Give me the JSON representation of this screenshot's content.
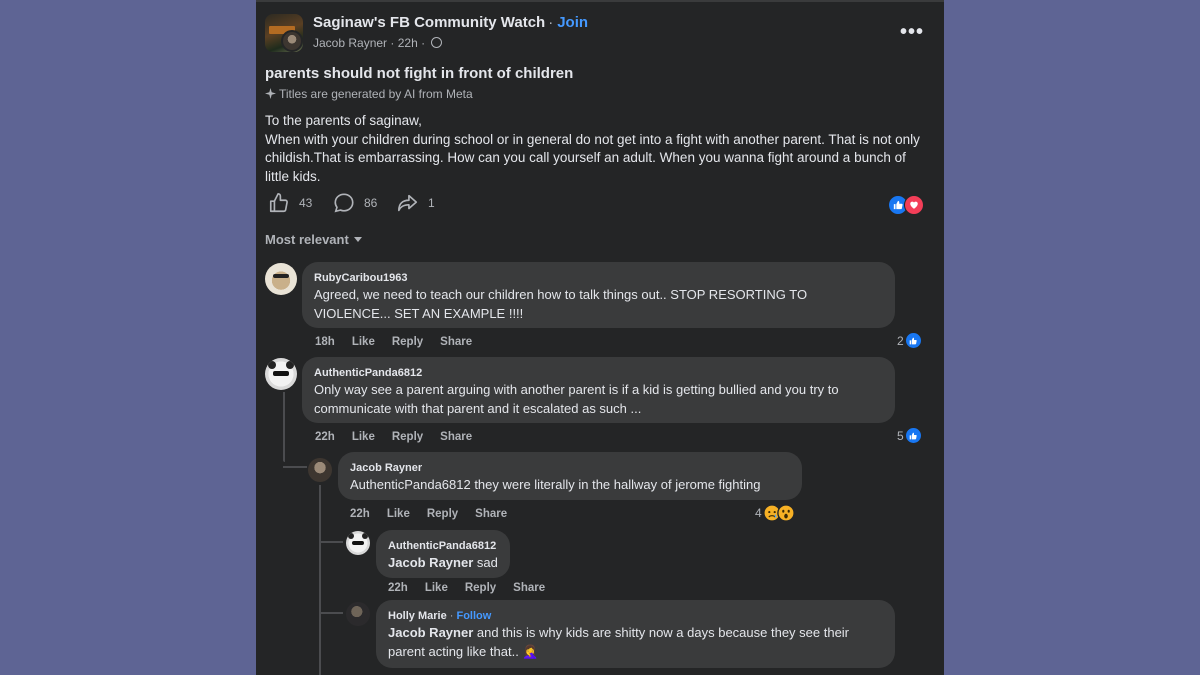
{
  "post": {
    "group_name": "Saginaw's FB Community Watch",
    "separator": "·",
    "join_label": "Join",
    "author": "Jacob Rayner",
    "time": "22h",
    "more_label": "•••",
    "title": "parents should not fight in front of children",
    "ai_note": "Titles are generated by AI from Meta",
    "body_line1": "To the parents of saginaw,",
    "body_line2": "When with your children during school or in general do not get into a fight with another parent. That is not only childish.That is embarrassing. How can you call yourself an adult. When you wanna fight around a bunch of little kids.",
    "likes": "43",
    "comments": "86",
    "shares": "1"
  },
  "sort_label": "Most relevant",
  "comment_actions": {
    "like": "Like",
    "reply": "Reply",
    "share": "Share"
  },
  "comments": [
    {
      "name": "RubyCaribou1963",
      "text": "Agreed, we need to teach our children how to talk things out.. STOP RESORTING TO VIOLENCE... SET AN EXAMPLE !!!!",
      "time": "18h",
      "reactions": "2"
    },
    {
      "name": "AuthenticPanda6812",
      "text": "Only way see a parent arguing with another parent is if a kid is getting bullied and you try to communicate with that parent and it escalated as such ...",
      "time": "22h",
      "reactions": "5"
    },
    {
      "name": "Jacob Rayner",
      "text": "AuthenticPanda6812 they were literally in the hallway of jerome fighting",
      "time": "22h",
      "reactions": "4"
    },
    {
      "name": "AuthenticPanda6812",
      "mention": "Jacob Rayner",
      "text": " sad",
      "time": "22h"
    },
    {
      "name": "Holly Marie",
      "follow": "Follow",
      "mention": "Jacob Rayner",
      "text": " and this is why kids are shitty now a days because they see their parent acting like that.. 🤦‍♀️"
    }
  ],
  "colors": {
    "page_bg": "#5e6494",
    "panel_bg": "#242526",
    "bubble_bg": "#3a3b3c",
    "link_blue": "#4599ff",
    "like_blue": "#1877f2",
    "love_red": "#f33e58"
  }
}
